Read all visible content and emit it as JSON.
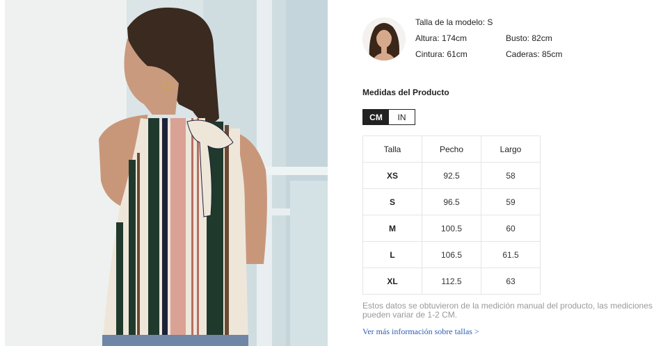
{
  "photo": {
    "alt_icon": "product-photo"
  },
  "model": {
    "size_label": "Talla de la modelo: S",
    "height": "Altura: 174cm",
    "waist": "Cintura: 61cm",
    "bust": "Busto: 82cm",
    "hips": "Caderas: 85cm"
  },
  "measurements": {
    "title": "Medidas del Producto",
    "units": [
      {
        "label": "CM",
        "active": true
      },
      {
        "label": "IN",
        "active": false
      }
    ],
    "headers": [
      "Talla",
      "Pecho",
      "Largo"
    ],
    "rows": [
      [
        "XS",
        "92.5",
        "58"
      ],
      [
        "S",
        "96.5",
        "59"
      ],
      [
        "M",
        "100.5",
        "60"
      ],
      [
        "L",
        "106.5",
        "61.5"
      ],
      [
        "XL",
        "112.5",
        "63"
      ]
    ],
    "note": "Estos datos se obtuvieron de la medición manual del producto, las mediciones pueden variar de 1-2 CM.",
    "more_link": "Ver más información sobre tallas >"
  },
  "colors": {
    "stripe_green": "#1f3a2c",
    "stripe_pink": "#d9a295",
    "stripe_cream": "#efe6da",
    "stripe_navy": "#1c2238",
    "link": "#2f5cb0",
    "toggle_active": "#222222"
  }
}
